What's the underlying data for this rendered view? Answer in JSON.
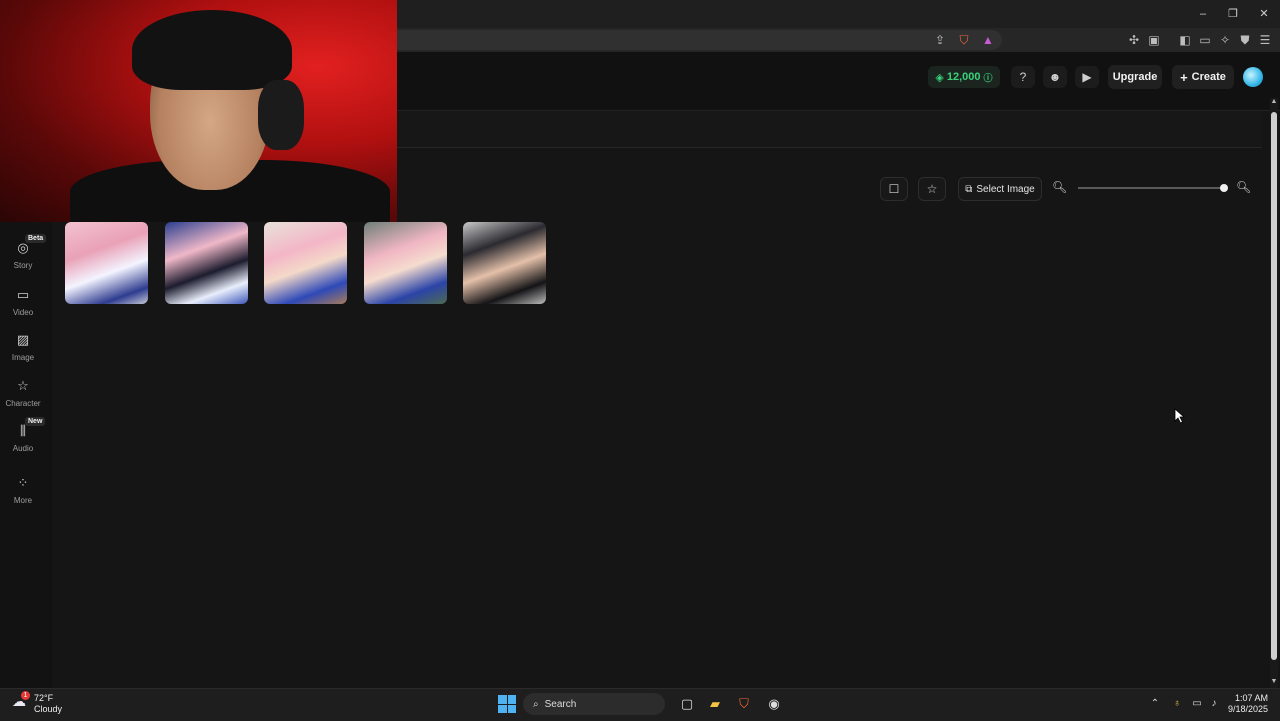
{
  "header": {
    "credits": "12,000",
    "upgrade_label": "Upgrade",
    "create_label": "Create"
  },
  "sidebar": {
    "items": [
      {
        "label": "Story",
        "badge": "Beta",
        "icon": "story-icon"
      },
      {
        "label": "Video",
        "icon": "video-icon"
      },
      {
        "label": "Image",
        "icon": "image-icon"
      },
      {
        "label": "Character",
        "icon": "character-icon"
      },
      {
        "label": "Audio",
        "badge": "New",
        "icon": "audio-icon"
      },
      {
        "label": "More",
        "icon": "more-icon"
      }
    ]
  },
  "toolbar": {
    "select_image_label": "Select Image",
    "zoom_level": 1.0
  },
  "gallery": {
    "count": 5
  },
  "taskbar": {
    "weather_temp": "72°F",
    "weather_condition": "Cloudy",
    "weather_badge": "1",
    "search_label": "Search",
    "time": "1:07 AM",
    "date": "9/18/2025"
  },
  "colors": {
    "accent_green": "#39d37a",
    "background": "#151515",
    "taskbar": "#1e1e1e"
  }
}
